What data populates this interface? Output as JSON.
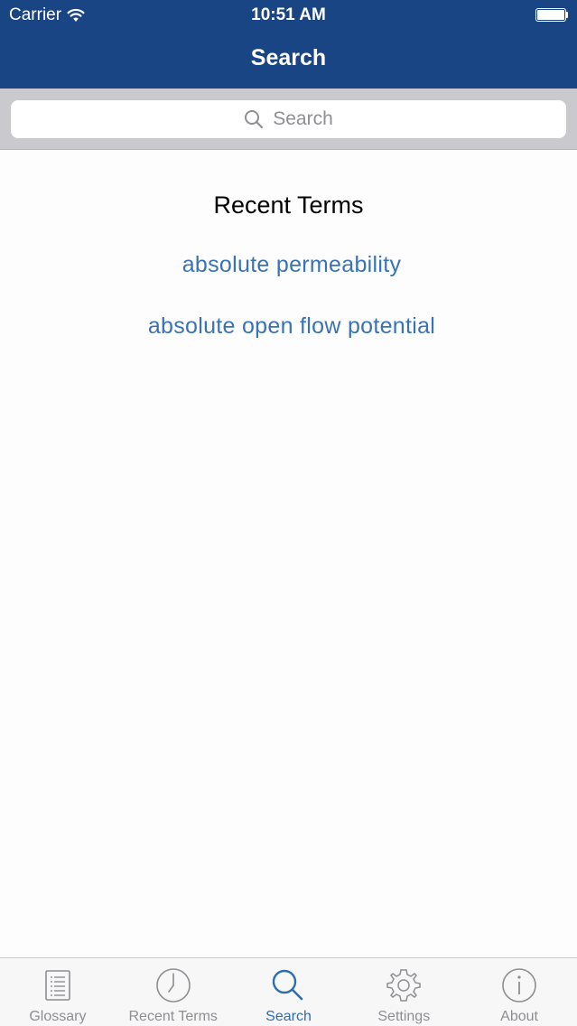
{
  "status_bar": {
    "carrier": "Carrier",
    "time": "10:51 AM",
    "wifi_icon": "wifi-icon",
    "battery_icon": "battery-icon"
  },
  "nav": {
    "title": "Search"
  },
  "search": {
    "placeholder": "Search",
    "icon": "search-icon"
  },
  "recent": {
    "heading": "Recent Terms",
    "terms": [
      "absolute permeability",
      "absolute open flow potential"
    ]
  },
  "tab_bar": {
    "active": "Search",
    "tabs": [
      {
        "label": "Glossary",
        "icon": "list-icon"
      },
      {
        "label": "Recent Terms",
        "icon": "clock-icon"
      },
      {
        "label": "Search",
        "icon": "search-icon"
      },
      {
        "label": "Settings",
        "icon": "gear-icon"
      },
      {
        "label": "About",
        "icon": "info-icon"
      }
    ]
  },
  "colors": {
    "header_bg": "#1a4584",
    "link": "#3a73b5",
    "tab_active": "#2f6db1",
    "tab_inactive": "#8e8e93",
    "search_bar_bg": "#c9c9ce"
  }
}
